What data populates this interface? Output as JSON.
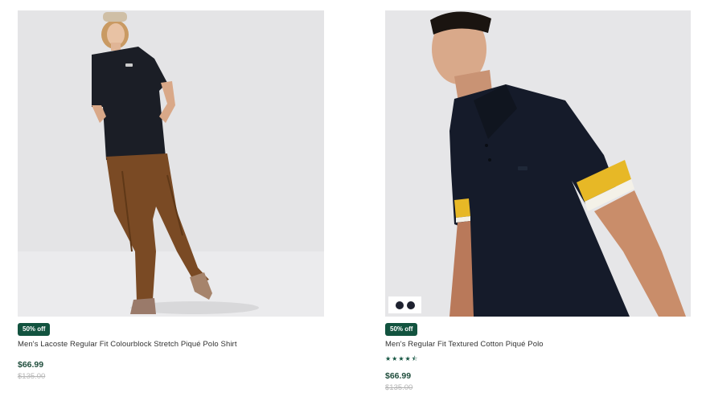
{
  "products": [
    {
      "image_alt": "Man in black polo shirt and brown corduroy trousers",
      "discount_badge": "50% off",
      "title": "Men's Lacoste Regular Fit Colourblock Stretch Piqué Polo Shirt",
      "price": "$66.99",
      "original_price": "$135.00"
    },
    {
      "image_alt": "Man in navy polo shirt with yellow sleeve stripe",
      "swatch_colors": [
        "#1e2230",
        "#1e2230"
      ],
      "discount_badge": "50% off",
      "title": "Men's Regular Fit Textured Cotton Piqué Polo",
      "rating_stars": "★★★★⯪",
      "rating_value": 4.5,
      "price": "$66.99",
      "original_price": "$135.00"
    }
  ],
  "colors": {
    "badge_bg": "#12533f",
    "price": "#1f4d3c",
    "old_price": "#b5b5b5",
    "image_bg": "#e3e3e5"
  }
}
